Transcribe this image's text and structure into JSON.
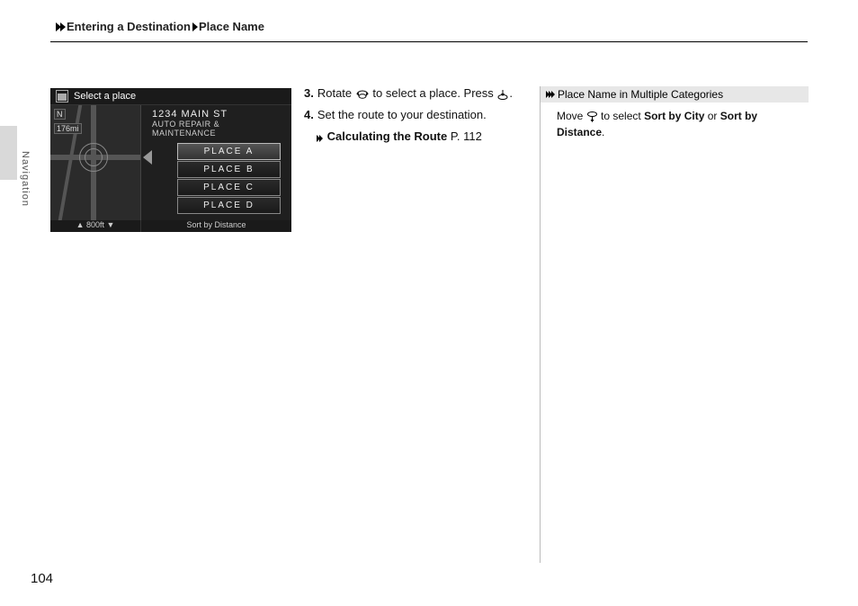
{
  "breadcrumb": {
    "section": "Entering a Destination",
    "subsection": "Place Name"
  },
  "side_label": "Navigation",
  "screenshot": {
    "title": "Select a place",
    "map_dist": "176mi",
    "address_line1": "1234 MAIN ST",
    "address_line2": "AUTO REPAIR & MAINTENANCE",
    "list": [
      "PLACE A",
      "PLACE B",
      "PLACE C",
      "PLACE D"
    ],
    "scale_text": "800ft",
    "sort_text": "Sort by Distance"
  },
  "steps": {
    "s3_num": "3.",
    "s3_a": "Rotate ",
    "s3_b": " to select a place. Press ",
    "s3_c": ".",
    "s4_num": "4.",
    "s4_a": "Set the route to your destination.",
    "s4_ref_bold": "Calculating the Route",
    "s4_ref_tail": " P. 112"
  },
  "sidebar": {
    "title": "Place Name in Multiple Categories",
    "body_a": "Move ",
    "body_b": " to select ",
    "body_s1": "Sort by City",
    "body_or": " or ",
    "body_s2": "Sort by Distance",
    "body_end": "."
  },
  "page_number": "104"
}
